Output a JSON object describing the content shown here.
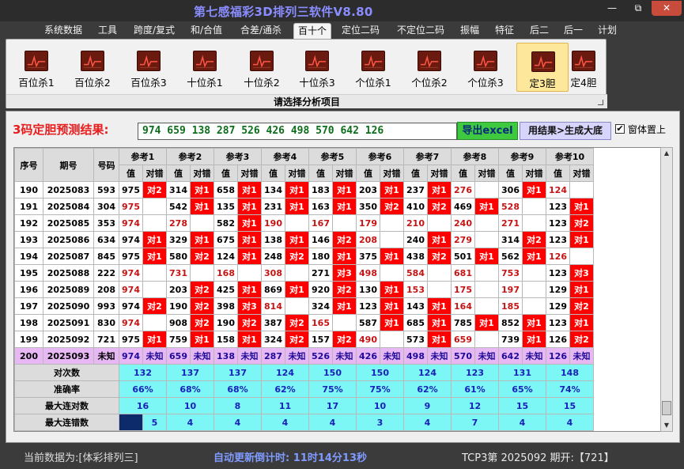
{
  "window": {
    "title": "第七感福彩3D排列三软件V8.80",
    "min": "—",
    "max": "⧉",
    "close": "✕"
  },
  "menu": [
    "系统数据",
    "工具",
    "跨度/复式",
    "和/合值",
    "合差/通杀",
    "百十个",
    "定位二码",
    "不定位二码",
    "振幅",
    "特征",
    "后二",
    "后一",
    "计划"
  ],
  "menu_active": "百十个",
  "ribbon": {
    "buttons": [
      "百位杀1",
      "百位杀2",
      "百位杀3",
      "十位杀1",
      "十位杀2",
      "十位杀3",
      "个位杀1",
      "个位杀2",
      "个位杀3",
      "定3胆",
      "定4胆"
    ],
    "selected": "定3胆",
    "caption": "请选择分析项目"
  },
  "prediction": {
    "label": "3码定胆预测结果:",
    "value": "974 659 138 287 526 426 498 570 642 126"
  },
  "buttons": {
    "excel": "导出excel",
    "generate": "用结果>生成大底"
  },
  "checkbox": {
    "label": "窗体置上",
    "checked": true,
    "mark": "✔"
  },
  "table": {
    "headers": {
      "seq": "序号",
      "period": "期号",
      "code": "号码",
      "value": "值",
      "hit": "对错"
    },
    "groups": [
      "参考1",
      "参考2",
      "参考3",
      "参考4",
      "参考5",
      "参考6",
      "参考7",
      "参考8",
      "参考9",
      "参考10"
    ],
    "rows": [
      {
        "seq": "190",
        "period": "2025083",
        "code": "593",
        "refs": [
          [
            "975",
            "对2"
          ],
          [
            "314",
            "对1"
          ],
          [
            "658",
            "对1"
          ],
          [
            "134",
            "对1"
          ],
          [
            "183",
            "对1"
          ],
          [
            "203",
            "对1"
          ],
          [
            "237",
            "对1"
          ],
          [
            "276",
            ""
          ],
          [
            "306",
            "对1"
          ],
          [
            "124",
            ""
          ]
        ]
      },
      {
        "seq": "191",
        "period": "2025084",
        "code": "304",
        "refs": [
          [
            "975",
            ""
          ],
          [
            "542",
            "对1"
          ],
          [
            "135",
            "对1"
          ],
          [
            "231",
            "对1"
          ],
          [
            "163",
            "对1"
          ],
          [
            "350",
            "对2"
          ],
          [
            "410",
            "对2"
          ],
          [
            "469",
            "对1"
          ],
          [
            "528",
            ""
          ],
          [
            "123",
            "对1"
          ]
        ]
      },
      {
        "seq": "192",
        "period": "2025085",
        "code": "353",
        "refs": [
          [
            "974",
            ""
          ],
          [
            "278",
            ""
          ],
          [
            "582",
            "对1"
          ],
          [
            "190",
            ""
          ],
          [
            "167",
            ""
          ],
          [
            "179",
            ""
          ],
          [
            "210",
            ""
          ],
          [
            "240",
            ""
          ],
          [
            "271",
            ""
          ],
          [
            "123",
            "对2"
          ]
        ]
      },
      {
        "seq": "193",
        "period": "2025086",
        "code": "634",
        "refs": [
          [
            "974",
            "对1"
          ],
          [
            "329",
            "对1"
          ],
          [
            "675",
            "对1"
          ],
          [
            "138",
            "对1"
          ],
          [
            "146",
            "对2"
          ],
          [
            "208",
            ""
          ],
          [
            "240",
            "对1"
          ],
          [
            "279",
            ""
          ],
          [
            "314",
            "对2"
          ],
          [
            "123",
            "对1"
          ]
        ]
      },
      {
        "seq": "194",
        "period": "2025087",
        "code": "845",
        "refs": [
          [
            "975",
            "对1"
          ],
          [
            "580",
            "对2"
          ],
          [
            "124",
            "对1"
          ],
          [
            "248",
            "对2"
          ],
          [
            "180",
            "对1"
          ],
          [
            "375",
            "对1"
          ],
          [
            "438",
            "对2"
          ],
          [
            "501",
            "对1"
          ],
          [
            "562",
            "对1"
          ],
          [
            "126",
            ""
          ]
        ]
      },
      {
        "seq": "195",
        "period": "2025088",
        "code": "222",
        "refs": [
          [
            "974",
            ""
          ],
          [
            "731",
            ""
          ],
          [
            "168",
            ""
          ],
          [
            "308",
            ""
          ],
          [
            "271",
            "对3"
          ],
          [
            "498",
            ""
          ],
          [
            "584",
            ""
          ],
          [
            "681",
            ""
          ],
          [
            "753",
            ""
          ],
          [
            "123",
            "对3"
          ]
        ]
      },
      {
        "seq": "196",
        "period": "2025089",
        "code": "208",
        "refs": [
          [
            "974",
            ""
          ],
          [
            "203",
            "对2"
          ],
          [
            "425",
            "对1"
          ],
          [
            "869",
            "对1"
          ],
          [
            "920",
            "对2"
          ],
          [
            "130",
            "对1"
          ],
          [
            "153",
            ""
          ],
          [
            "175",
            ""
          ],
          [
            "197",
            ""
          ],
          [
            "129",
            "对1"
          ]
        ]
      },
      {
        "seq": "197",
        "period": "2025090",
        "code": "993",
        "refs": [
          [
            "974",
            "对2"
          ],
          [
            "190",
            "对2"
          ],
          [
            "398",
            "对3"
          ],
          [
            "814",
            ""
          ],
          [
            "324",
            "对1"
          ],
          [
            "123",
            "对1"
          ],
          [
            "143",
            "对1"
          ],
          [
            "164",
            ""
          ],
          [
            "185",
            ""
          ],
          [
            "129",
            "对2"
          ]
        ]
      },
      {
        "seq": "198",
        "period": "2025091",
        "code": "830",
        "refs": [
          [
            "974",
            ""
          ],
          [
            "908",
            "对2"
          ],
          [
            "190",
            "对2"
          ],
          [
            "387",
            "对2"
          ],
          [
            "165",
            ""
          ],
          [
            "587",
            "对1"
          ],
          [
            "685",
            "对1"
          ],
          [
            "785",
            "对1"
          ],
          [
            "852",
            "对1"
          ],
          [
            "123",
            "对1"
          ]
        ]
      },
      {
        "seq": "199",
        "period": "2025092",
        "code": "721",
        "refs": [
          [
            "975",
            "对1"
          ],
          [
            "759",
            "对1"
          ],
          [
            "158",
            "对1"
          ],
          [
            "324",
            "对2"
          ],
          [
            "157",
            "对2"
          ],
          [
            "490",
            ""
          ],
          [
            "573",
            "对1"
          ],
          [
            "659",
            ""
          ],
          [
            "739",
            "对1"
          ],
          [
            "126",
            "对2"
          ]
        ]
      },
      {
        "seq": "200",
        "period": "2025093",
        "code": "未知",
        "refs": [
          [
            "974",
            "未知"
          ],
          [
            "659",
            "未知"
          ],
          [
            "138",
            "未知"
          ],
          [
            "287",
            "未知"
          ],
          [
            "526",
            "未知"
          ],
          [
            "426",
            "未知"
          ],
          [
            "498",
            "未知"
          ],
          [
            "570",
            "未知"
          ],
          [
            "642",
            "未知"
          ],
          [
            "126",
            "未知"
          ]
        ]
      }
    ],
    "stats": [
      {
        "label": "对次数",
        "values": [
          "132",
          "137",
          "137",
          "124",
          "150",
          "150",
          "124",
          "123",
          "131",
          "148"
        ]
      },
      {
        "label": "准确率",
        "values": [
          "66%",
          "68%",
          "68%",
          "62%",
          "75%",
          "75%",
          "62%",
          "61%",
          "65%",
          "74%"
        ]
      },
      {
        "label": "最大连对数",
        "values": [
          "16",
          "10",
          "8",
          "11",
          "17",
          "10",
          "9",
          "12",
          "15",
          "15"
        ]
      },
      {
        "label": "最大连错数",
        "values": [
          "5",
          "4",
          "4",
          "4",
          "4",
          "3",
          "4",
          "7",
          "4",
          "4"
        ]
      }
    ]
  },
  "colors": {
    "hit": "#ff0000",
    "miss_value": "#c41414",
    "unknown_row": "#e8b8f5",
    "stat_bg": "#7df6f6",
    "title": "#8a8dff"
  },
  "status": {
    "current_data": "当前数据为:[体彩排列三]",
    "countdown": "自动更新倒计时:  11时14分13秒",
    "issue": "TCP3第 2025092 期开:【721】"
  }
}
